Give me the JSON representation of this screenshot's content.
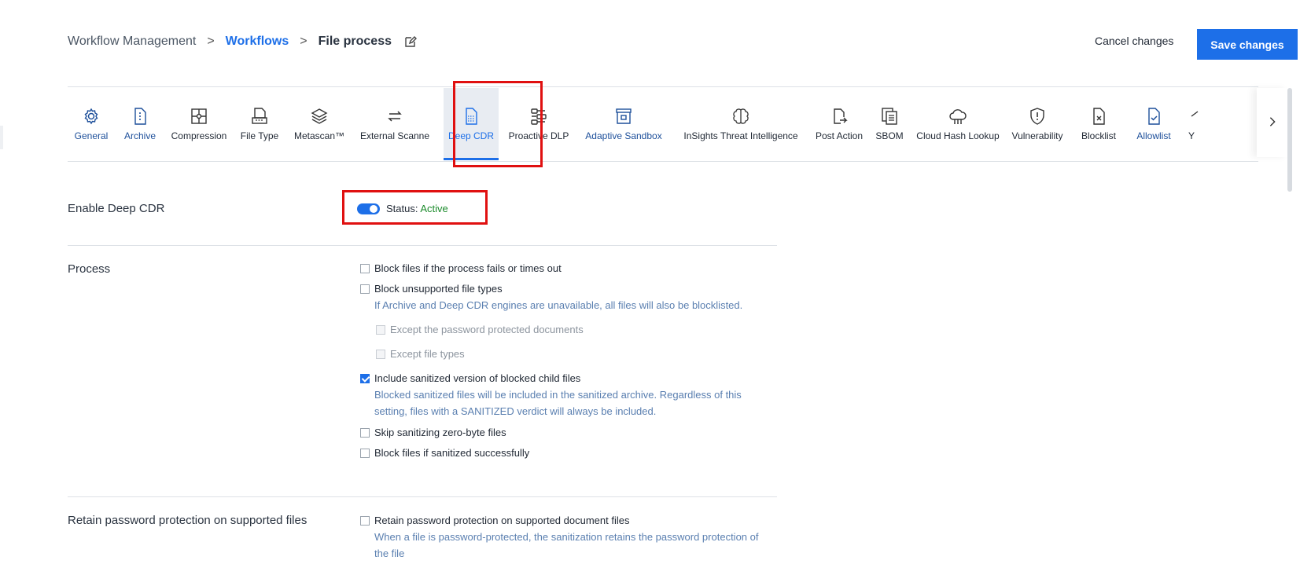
{
  "breadcrumb": {
    "root": "Workflow Management",
    "parent": "Workflows",
    "current": "File process",
    "separator": ">"
  },
  "actions": {
    "cancel_label": "Cancel changes",
    "save_label": "Save changes"
  },
  "tabs": [
    {
      "label": "General",
      "icon": "gear-icon"
    },
    {
      "label": "Archive",
      "icon": "archive-file-icon"
    },
    {
      "label": "Compression",
      "icon": "compression-icon"
    },
    {
      "label": "File Type",
      "icon": "file-type-icon"
    },
    {
      "label": "Metascan™",
      "icon": "layers-icon"
    },
    {
      "label": "External Scanne",
      "icon": "swap-arrows-icon"
    },
    {
      "label": "Deep CDR",
      "icon": "deep-cdr-icon"
    },
    {
      "label": "Proactive DLP",
      "icon": "dlp-icon"
    },
    {
      "label": "Adaptive Sandbox",
      "icon": "sandbox-icon"
    },
    {
      "label": "InSights Threat Intelligence",
      "icon": "brain-icon"
    },
    {
      "label": "Post Action",
      "icon": "post-action-icon"
    },
    {
      "label": "SBOM",
      "icon": "sbom-icon"
    },
    {
      "label": "Cloud Hash Lookup",
      "icon": "cloud-icon"
    },
    {
      "label": "Vulnerability",
      "icon": "shield-alert-icon"
    },
    {
      "label": "Blocklist",
      "icon": "blocklist-icon"
    },
    {
      "label": "Allowlist",
      "icon": "allowlist-icon"
    },
    {
      "label": "Y",
      "icon": "truncated-tab-icon"
    }
  ],
  "tab_scroll_icon": "chevron-right-icon",
  "enable": {
    "label": "Enable Deep CDR",
    "status_prefix": "Status:",
    "status_value": "Active",
    "on": true
  },
  "process": {
    "label": "Process",
    "options": {
      "block_fail": "Block files if the process fails or times out",
      "block_unsupported": "Block unsupported file types",
      "block_unsupported_help": "If Archive and Deep CDR engines are unavailable, all files will also be blocklisted.",
      "except_password": "Except the password protected documents",
      "except_types": "Except file types",
      "include_sanitized": "Include sanitized version of blocked child files",
      "include_sanitized_help_1": "Blocked sanitized files will be included in the sanitized archive. Regardless of this",
      "include_sanitized_help_2": "setting, files with a SANITIZED verdict will always be included.",
      "skip_zero": "Skip sanitizing zero-byte files",
      "block_sanitized": "Block files if sanitized successfully"
    }
  },
  "retain": {
    "label": "Retain password protection on supported files",
    "option": "Retain password protection on supported document files",
    "help_1": "When a file is password-protected, the sanitization retains the password protection of",
    "help_2": "the file"
  },
  "colors": {
    "accent": "#1d6fe8",
    "active_status": "#1a8a2a",
    "highlight_box": "#e01010"
  }
}
